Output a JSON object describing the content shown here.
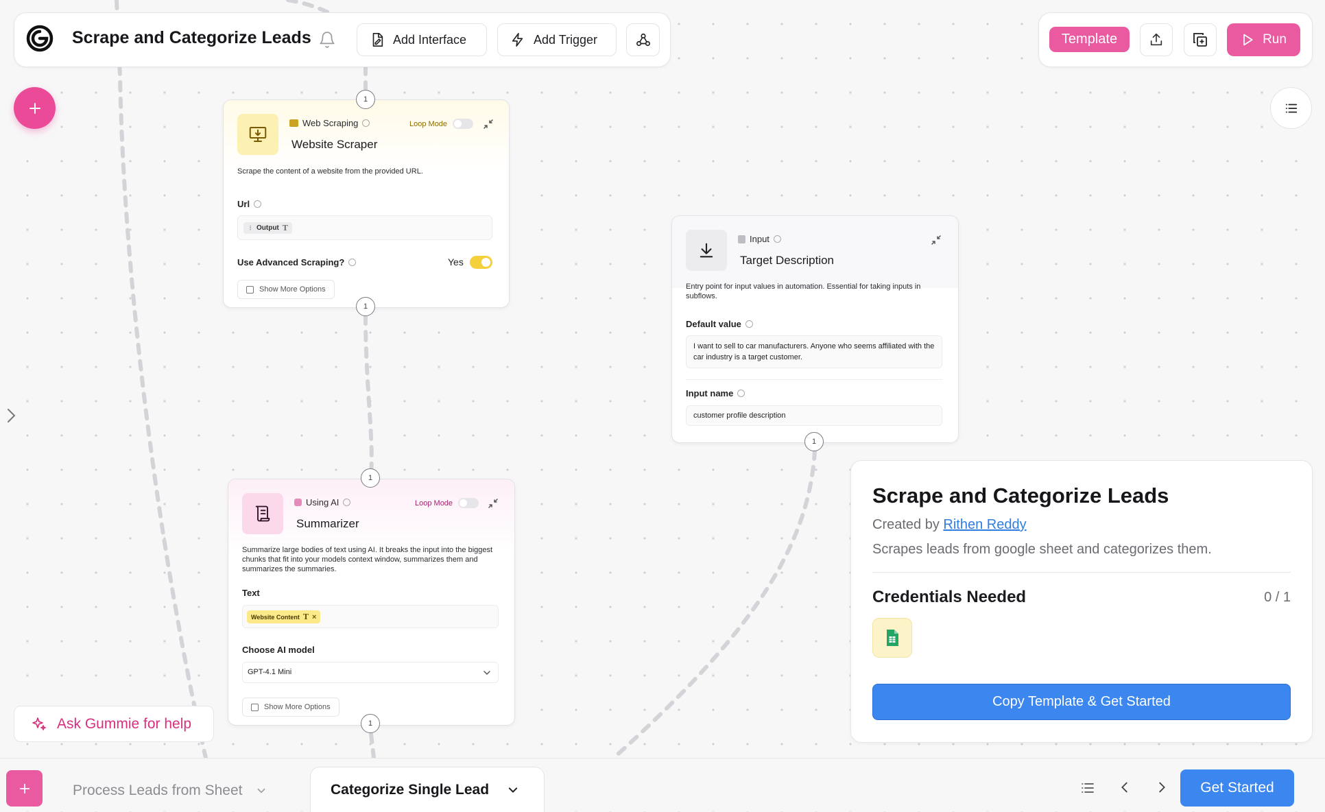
{
  "header": {
    "title": "Scrape and Categorize Leads",
    "add_interface_label": "Add Interface",
    "add_trigger_label": "Add Trigger",
    "template_label": "Template",
    "run_label": "Run"
  },
  "nodes": {
    "website_scraper": {
      "category": "Web Scraping",
      "name": "Website Scraper",
      "loop_mode_label": "Loop Mode",
      "description": "Scrape the content of a website from the provided URL.",
      "url_label": "Url",
      "url_chip": "Output",
      "advanced_label": "Use Advanced Scraping?",
      "advanced_value": "Yes",
      "show_more_label": "Show More Options",
      "badge_in": "1",
      "badge_out": "1"
    },
    "target_description": {
      "category": "Input",
      "name": "Target Description",
      "description": "Entry point for input values in automation. Essential for taking inputs in subflows.",
      "default_value_label": "Default value",
      "default_value": "I want to sell to car manufacturers. Anyone who seems affiliated with the car industry is a target customer.",
      "input_name_label": "Input name",
      "input_name": "customer profile description",
      "badge_out": "1"
    },
    "summarizer": {
      "category": "Using AI",
      "name": "Summarizer",
      "loop_mode_label": "Loop Mode",
      "description": "Summarize large bodies of text using AI. It breaks the input into the biggest chunks that fit into your models context window, summarizes them and summarizes the summaries.",
      "text_label": "Text",
      "text_chip": "Website Content",
      "model_label": "Choose AI model",
      "model_value": "GPT-4.1 Mini",
      "show_more_label": "Show More Options",
      "badge_in": "1",
      "badge_out": "1"
    }
  },
  "info_card": {
    "title": "Scrape and Categorize Leads",
    "created_by_prefix": "Created by",
    "author": "Rithen Reddy",
    "description": "Scrapes leads from google sheet and categorizes them.",
    "credentials_title": "Credentials Needed",
    "credentials_count": "0 / 1",
    "credential_icon": "google-sheets-icon",
    "copy_button_label": "Copy Template & Get Started"
  },
  "help_button_label": "Ask Gummie for help",
  "bottom_bar": {
    "tabs": [
      {
        "label": "Process Leads from Sheet",
        "active": false
      },
      {
        "label": "Categorize Single Lead",
        "active": true
      }
    ],
    "get_started_label": "Get Started"
  },
  "colors": {
    "accent_pink": "#ea5aa1",
    "primary_blue": "#3b86ef",
    "link_blue": "#2f7de1",
    "toggle_on": "#f5d03b"
  }
}
